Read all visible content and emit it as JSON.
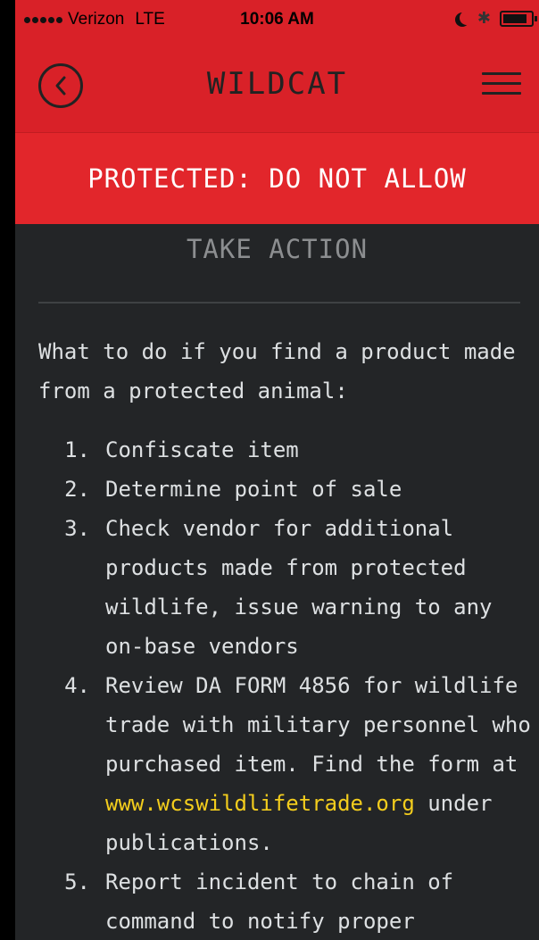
{
  "status_bar": {
    "carrier": "Verizon",
    "network": "LTE",
    "time": "10:06 AM"
  },
  "nav": {
    "title": "WILDCAT",
    "back_icon": "chevron-left-circle-icon",
    "menu_icon": "hamburger-menu-icon"
  },
  "banner": {
    "text": "PROTECTED: DO NOT ALLOW",
    "color": "#e2262b"
  },
  "section": {
    "title": "TAKE ACTION"
  },
  "content": {
    "intro": "What to do if you find a product made from a protected animal:",
    "steps": [
      {
        "number": "1.",
        "text": "Confiscate item"
      },
      {
        "number": "2.",
        "text": "Determine point of sale"
      },
      {
        "number": "3.",
        "text": "Check vendor for additional products made from protected wildlife, issue warning to any on-base vendors"
      },
      {
        "number": "4.",
        "text_before": "Review DA FORM 4856 for wildlife trade with military personnel who purchased item. Find the form at",
        "link": "www.wcswildlifetrade.org",
        "text_after": "under publications."
      },
      {
        "number": "5.",
        "text": "Report incident to chain of command to notify proper"
      }
    ]
  },
  "colors": {
    "brand_red": "#d92128",
    "background": "#232527",
    "link": "#f3cd1d"
  }
}
